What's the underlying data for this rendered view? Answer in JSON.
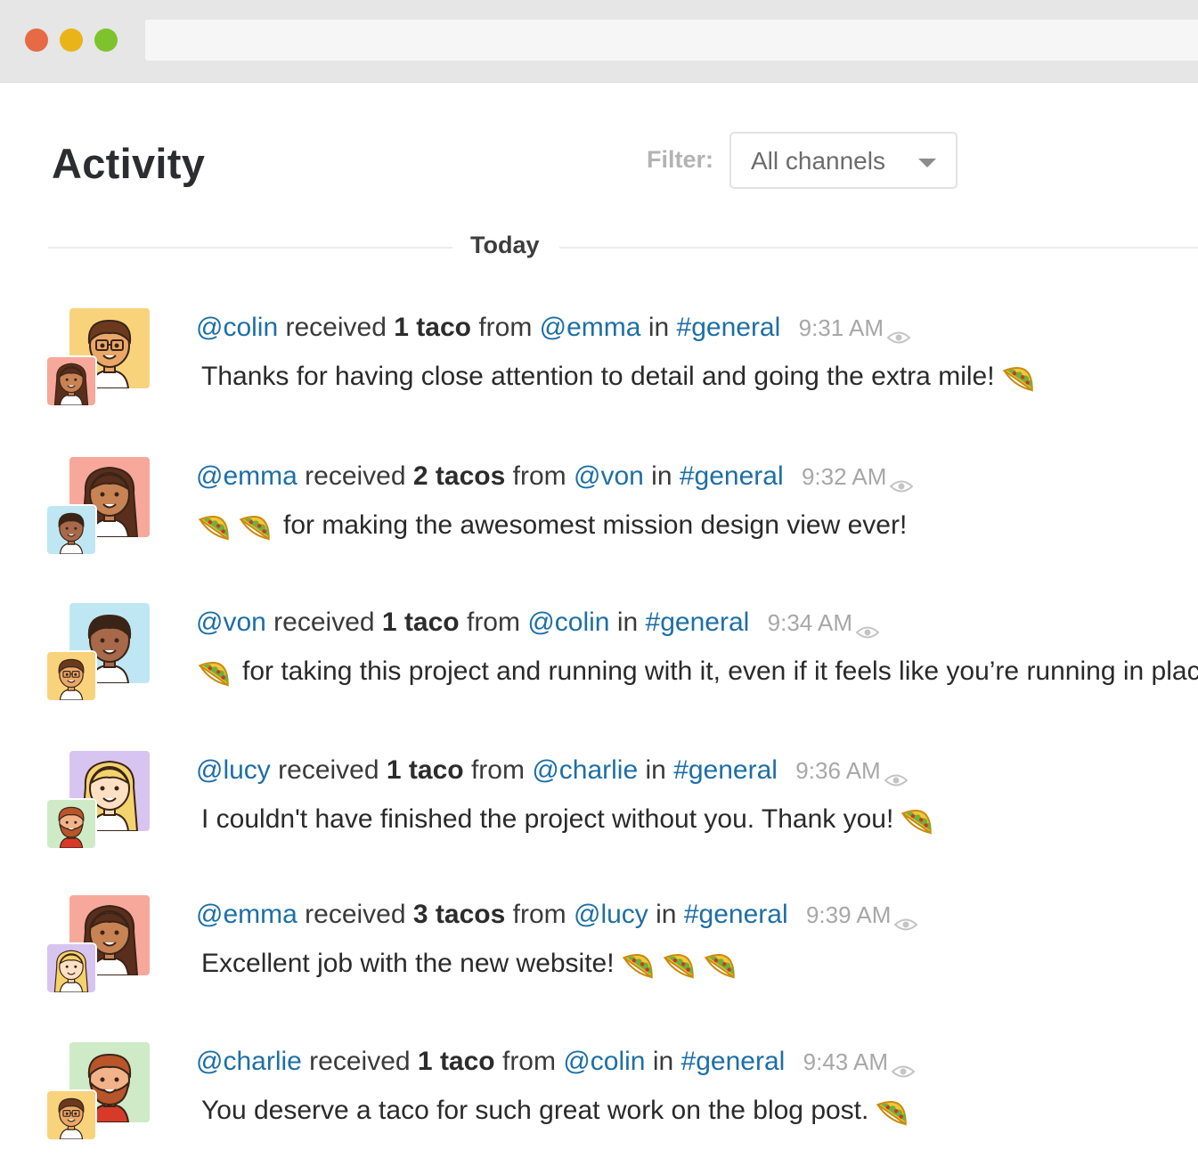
{
  "window": {
    "controls": [
      "close",
      "minimize",
      "maximize"
    ],
    "address_bar": ""
  },
  "header": {
    "title": "Activity",
    "filter_label": "Filter:",
    "filter_value": "All channels"
  },
  "section": {
    "label": "Today"
  },
  "colors": {
    "mention": "#1d6fa6",
    "timestamp": "#a7a7a7",
    "close": "#e66a43",
    "minimize": "#e8b418",
    "maximize": "#7ec32b"
  },
  "entries": [
    {
      "recipient": "@colin",
      "received": "received",
      "count": "1 taco",
      "from_word": "from",
      "sender": "@emma",
      "in_word": "in",
      "channel": "#general",
      "time": "9:31 AM",
      "message_before": "",
      "message_after": "Thanks for having close attention to detail and going the extra mile!",
      "tacos_before": 0,
      "tacos_after": 1,
      "avatar": "colin-avatar",
      "sender_avatar": "emma-avatar"
    },
    {
      "recipient": "@emma",
      "received": "received",
      "count": "2 tacos",
      "from_word": "from",
      "sender": "@von",
      "in_word": "in",
      "channel": "#general",
      "time": "9:32 AM",
      "message_before": "",
      "message_after": "for making the awesomest mission design view ever!",
      "tacos_before": 2,
      "tacos_after": 0,
      "avatar": "emma-avatar",
      "sender_avatar": "von-avatar"
    },
    {
      "recipient": "@von",
      "received": "received",
      "count": "1 taco",
      "from_word": "from",
      "sender": "@colin",
      "in_word": "in",
      "channel": "#general",
      "time": "9:34 AM",
      "message_before": "",
      "message_after": "for taking this project and running with it, even if it feels like you’re running in plac",
      "tacos_before": 1,
      "tacos_after": 0,
      "avatar": "von-avatar",
      "sender_avatar": "colin-avatar"
    },
    {
      "recipient": "@lucy",
      "received": "received",
      "count": "1 taco",
      "from_word": "from",
      "sender": "@charlie",
      "in_word": "in",
      "channel": "#general",
      "time": "9:36 AM",
      "message_before": "",
      "message_after": "I couldn't have finished the project without you. Thank you!",
      "tacos_before": 0,
      "tacos_after": 1,
      "avatar": "lucy-avatar",
      "sender_avatar": "charlie-avatar"
    },
    {
      "recipient": "@emma",
      "received": "received",
      "count": "3 tacos",
      "from_word": "from",
      "sender": "@lucy",
      "in_word": "in",
      "channel": "#general",
      "time": "9:39 AM",
      "message_before": "",
      "message_after": "Excellent job with the new website!",
      "tacos_before": 0,
      "tacos_after": 3,
      "avatar": "emma-avatar",
      "sender_avatar": "lucy-avatar"
    },
    {
      "recipient": "@charlie",
      "received": "received",
      "count": "1 taco",
      "from_word": "from",
      "sender": "@colin",
      "in_word": "in",
      "channel": "#general",
      "time": "9:43 AM",
      "message_before": "",
      "message_after": "You deserve a taco for such great work on the blog post.",
      "tacos_before": 0,
      "tacos_after": 1,
      "avatar": "charlie-avatar",
      "sender_avatar": "colin-avatar"
    }
  ]
}
